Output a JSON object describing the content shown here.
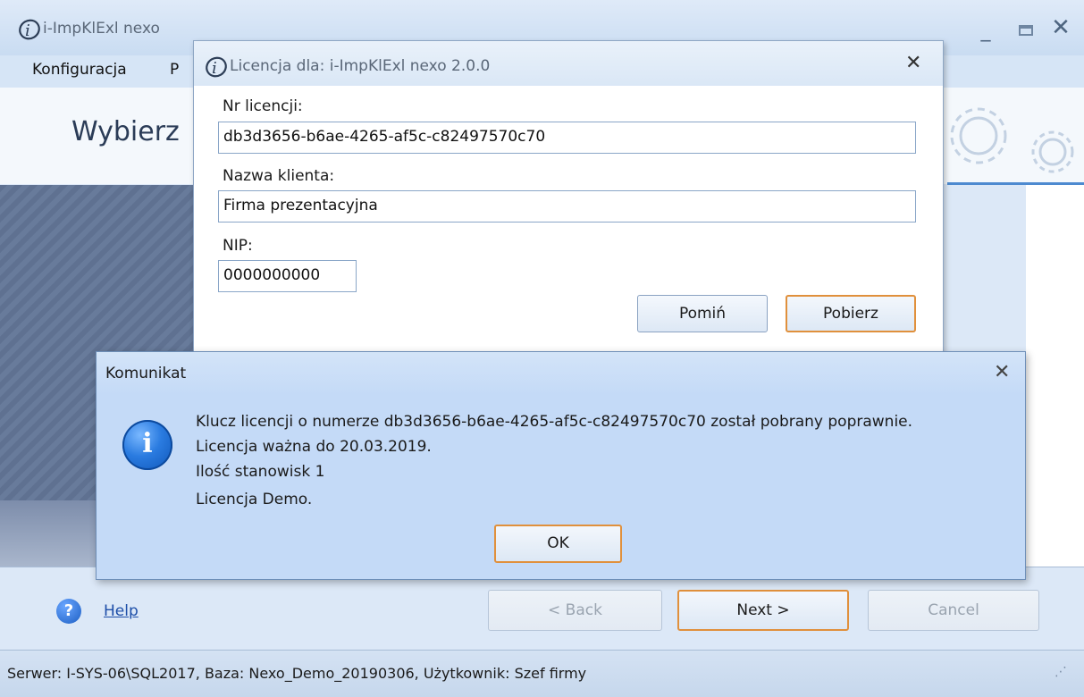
{
  "main_window": {
    "title": "i-ImpKlExl nexo",
    "menu": [
      "Konfiguracja",
      "P"
    ],
    "header_title": "Wybierz",
    "buttons": {
      "back": "<  Back",
      "next": "Next  >",
      "cancel": "Cancel"
    },
    "help": "Help",
    "status": "Serwer: I-SYS-06\\SQL2017, Baza: Nexo_Demo_20190306, Użytkownik: Szef firmy"
  },
  "license_dialog": {
    "title": "Licencja dla: i-ImpKlExl nexo 2.0.0",
    "license_number_label": "Nr licencji:",
    "license_number_value": "db3d3656-b6ae-4265-af5c-c82497570c70",
    "client_name_label": "Nazwa klienta:",
    "client_name_value": "Firma prezentacyjna",
    "nip_label": "NIP:",
    "nip_value": "0000000000",
    "skip_button": "Pomiń",
    "fetch_button": "Pobierz"
  },
  "message_box": {
    "title": "Komunikat",
    "lines": [
      "Klucz licencji o numerze db3d3656-b6ae-4265-af5c-c82497570c70 został pobrany poprawnie.",
      "Licencja ważna do 20.03.2019.",
      "Ilość stanowisk 1",
      "Licencja Demo."
    ],
    "ok_button": "OK",
    "icon": "info-icon"
  },
  "colors": {
    "accent_border": "#e0903c",
    "title_bar": "#dce8f7",
    "message_bg": "#c4daf7"
  }
}
